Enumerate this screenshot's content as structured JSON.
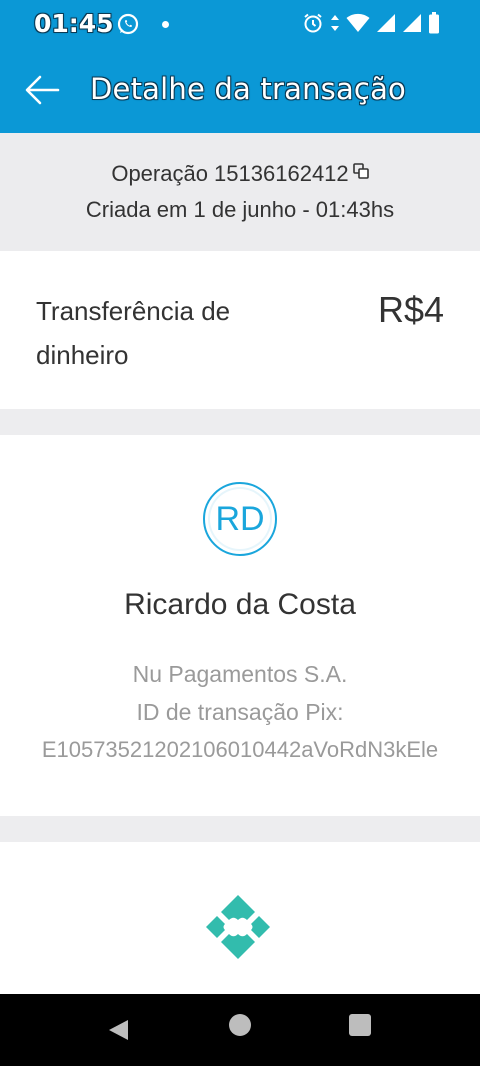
{
  "status_bar": {
    "time": "01:45",
    "icons": [
      "whatsapp-icon",
      "notification-dot",
      "alarm-icon",
      "data-arrows-icon",
      "wifi-icon",
      "signal-icon",
      "signal-icon",
      "battery-icon"
    ]
  },
  "app_bar": {
    "title": "Detalhe da transação",
    "back_icon": "arrow-left-icon"
  },
  "operation": {
    "label": "Operação 15136162412",
    "created": "Criada em 1 de junho - 01:43hs",
    "copy_icon": "copy-icon"
  },
  "transfer": {
    "label": "Transferência de dinheiro",
    "amount": "R$4"
  },
  "recipient": {
    "initials": "RD",
    "name": "Ricardo da Costa",
    "bank": "Nu Pagamentos S.A.",
    "pix_id_label": "ID de transação Pix:",
    "pix_id_value": "E10573521202106010442aVoRdN3kEle"
  },
  "pix": {
    "logo_icon": "pix-logo-icon"
  },
  "nav_bar": {
    "icons": [
      "nav-back-icon",
      "nav-home-icon",
      "nav-recents-icon"
    ]
  },
  "colors": {
    "primary": "#0b98d6",
    "avatar_accent": "#1aa6dc",
    "pix_green": "#32bcad",
    "text_dark": "#333333",
    "text_muted": "#9a9a9a",
    "background": "#ededef"
  }
}
